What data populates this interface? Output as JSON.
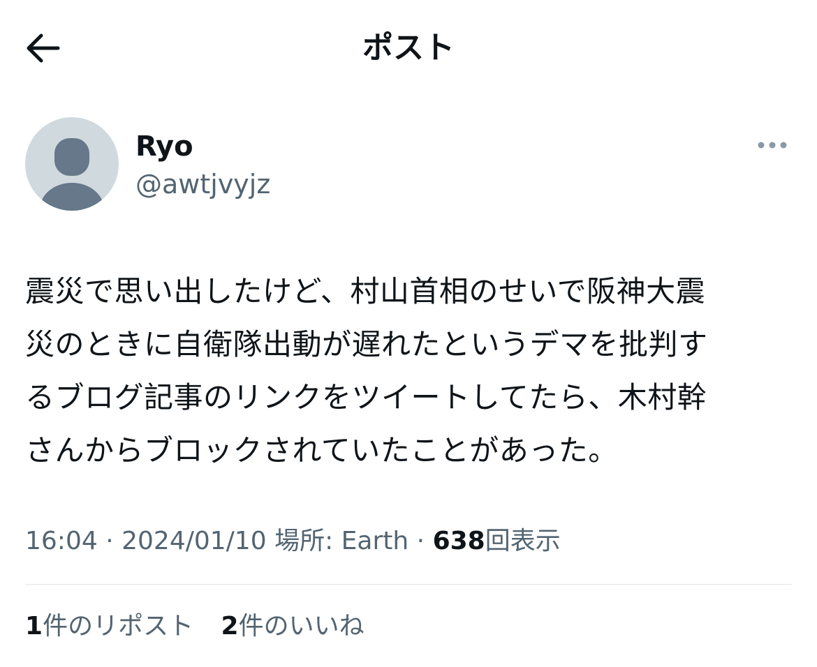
{
  "header": {
    "back_icon": "arrow-left-icon",
    "title": "ポスト"
  },
  "author": {
    "avatar_icon": "default-avatar-icon",
    "display_name": "Ryo",
    "handle": "@awtjvyjz",
    "more_icon": "more-horizontal-icon"
  },
  "post": {
    "lines": [
      "震災で思い出したけど、村山首相のせいで阪神大震",
      "災のときに自衛隊出動が遅れたというデマを批判す",
      "るブログ記事のリンクをツイートしてたら、木村幹",
      "さんからブロックされていたことがあった。"
    ]
  },
  "meta": {
    "time": "16:04",
    "separator": "·",
    "date": "2024/01/10",
    "location_label": "場所:",
    "location": "Earth",
    "views_count": "638",
    "views_label": "回表示"
  },
  "stats": {
    "reposts_count": "1",
    "reposts_label": "件のリポスト",
    "likes_count": "2",
    "likes_label": "件のいいね"
  },
  "colors": {
    "text_primary": "#0f1419",
    "text_secondary": "#536471",
    "avatar_bg": "#cfd9de",
    "avatar_fg": "#66788a",
    "divider": "#e1e7ea"
  }
}
